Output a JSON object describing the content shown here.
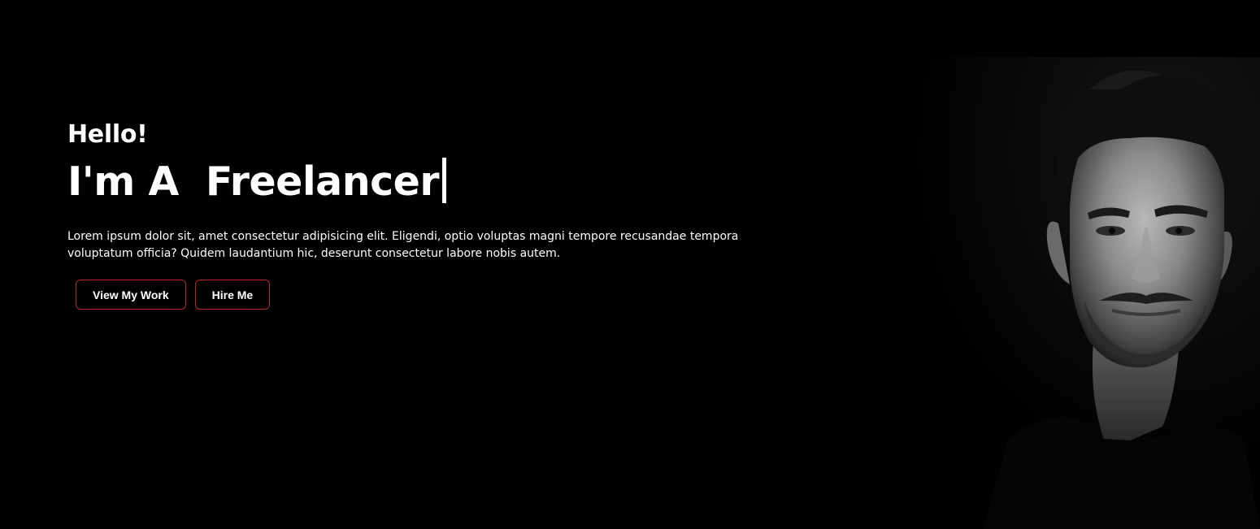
{
  "hero": {
    "greeting": "Hello!",
    "headline": "I'm A  Freelancer",
    "intro": "Lorem ipsum dolor sit, amet consectetur adipisicing elit. Eligendi, optio voluptas magni tempore recusandae tempora voluptatum officia? Quidem laudantium hic, deserunt consectetur labore nobis autem.",
    "buttons": {
      "view_work": "View My Work",
      "hire_me": "Hire Me"
    },
    "portrait_icon": "grayscale-man-portrait"
  },
  "colors": {
    "background": "#000000",
    "text": "#ffffff",
    "button_border": "#c0262b"
  }
}
